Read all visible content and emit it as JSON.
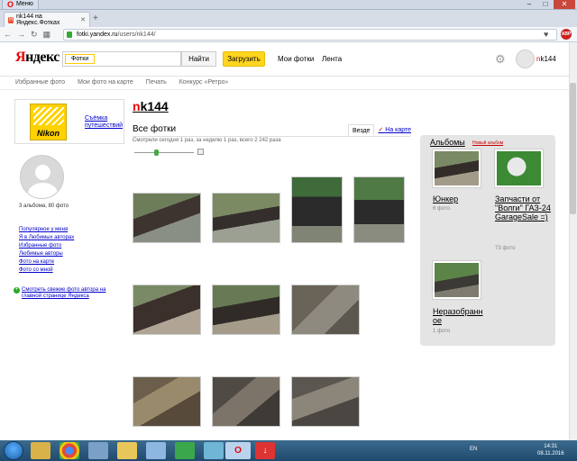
{
  "browser": {
    "menu_label": "Меню",
    "tab_title": "nk144 на Яндекс.Фотках",
    "url_host": "fotki.yandex.ru",
    "url_path": "/users/nk144/"
  },
  "header": {
    "logo_first": "Я",
    "logo_rest": "ндекс",
    "search_tag": "Фотки",
    "find_button": "Найти",
    "upload_button": "Загрузить",
    "nav_mine": "Мои фотки",
    "nav_feed": "Лента",
    "user_first": "n",
    "user_rest": "k144"
  },
  "subnav": [
    "Избранные фото",
    "Мои фото на карте",
    "Печать",
    "Конкурс «Ретро»"
  ],
  "profile": {
    "album_link": "Съёмка путешествий",
    "nikon_text": "Nikon",
    "counts": "3 альбома, 80 фото",
    "links": [
      "Популярное у меня",
      "Я в Любимых авторах",
      "Избранные фото",
      "Любимые авторы",
      "Фото на карте",
      "Фото со мной"
    ],
    "fresh_link": "Смотреть свежие фото автора на главной странице Яндекса"
  },
  "main": {
    "title_first": "n",
    "title_rest": "k144",
    "section": "Все фотки",
    "tab_all": "Везде",
    "tab_map": "На карте",
    "stats": "Смотрели сегодня 1 раз, за неделю 1 раз, всего 2 242 раза"
  },
  "albums": {
    "title": "Альбомы",
    "new_album": "Новый альбом",
    "items": [
      {
        "title": "Юнкер",
        "count": "6 фото"
      },
      {
        "title": "Запчасти от \"Волги\" ГАЗ-24 GarageSale =)",
        "count": "73 фото"
      },
      {
        "title": "Неразобранное",
        "count": "1 фото"
      }
    ]
  },
  "taskbar": {
    "lang": "EN",
    "time": "14:31",
    "date": "08.11.2016"
  }
}
